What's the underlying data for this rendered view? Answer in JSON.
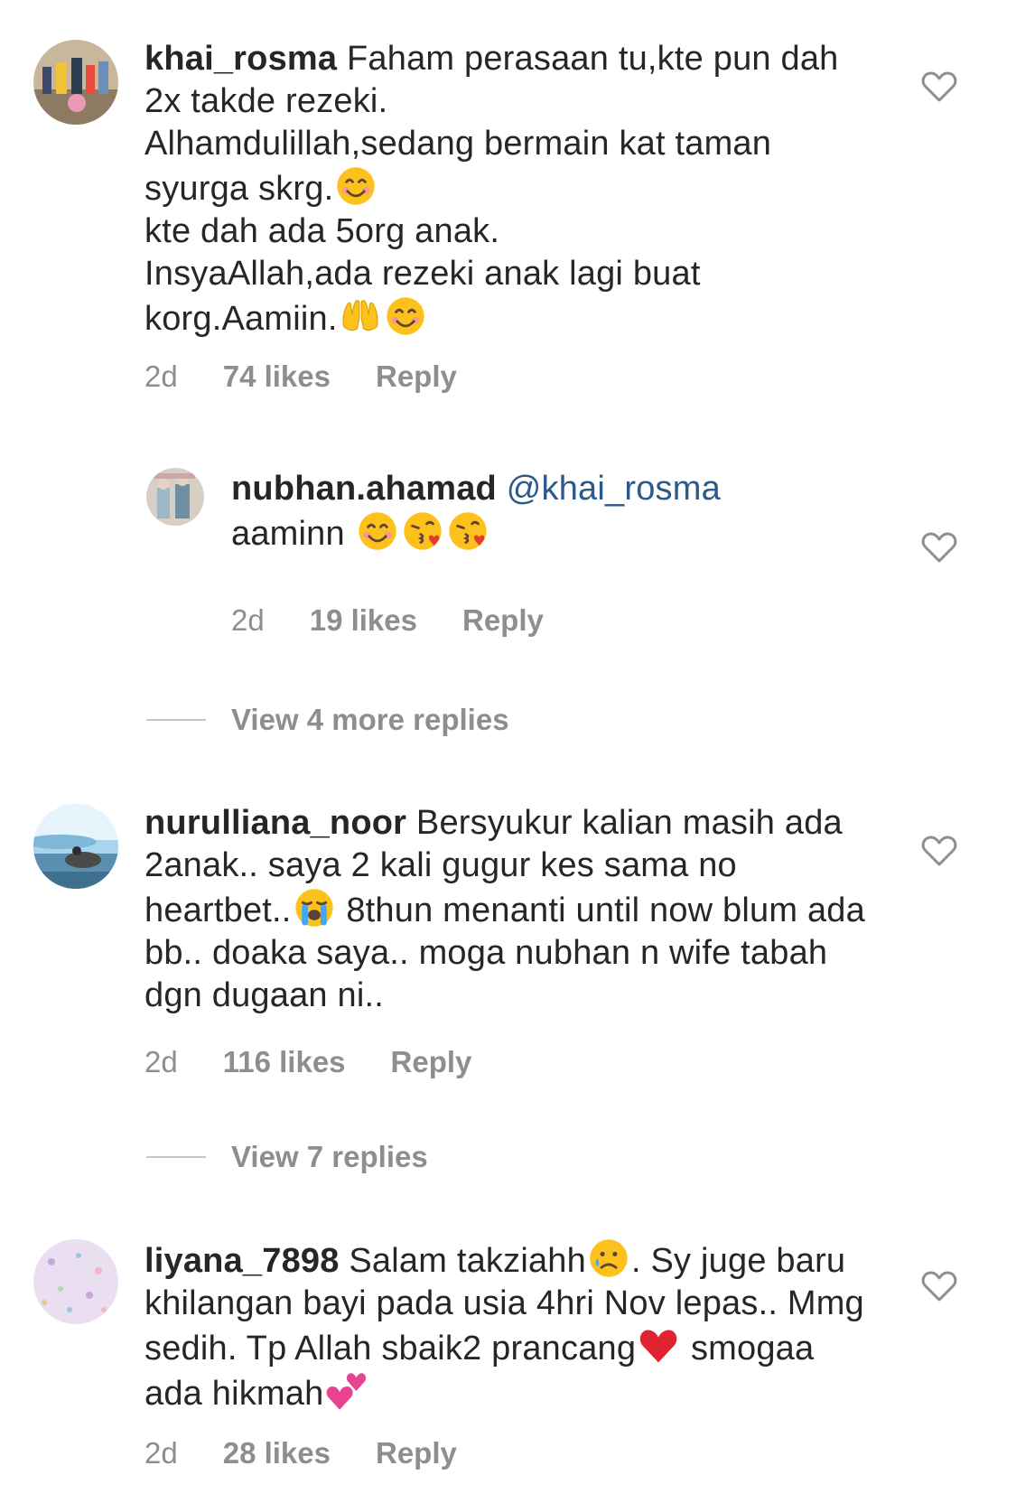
{
  "comments": [
    {
      "username": "khai_rosma",
      "body": " Faham perasaan tu,kte pun dah 2x takde rezeki.\nAlhamdulillah,sedang bermain kat taman syurga skrg.",
      "body2": "\nkte dah ada 5org anak.\nInsyaAllah,ada rezeki anak lagi buat korg.Aamiin.",
      "time": "2d",
      "likes": "74 likes",
      "reply": "Reply"
    },
    {
      "username": "nubhan.ahamad",
      "mention": " @khai_rosma",
      "body": "\naaminn ",
      "time": "2d",
      "likes": "19 likes",
      "reply": "Reply"
    },
    {
      "username": "nurulliana_noor",
      "body": " Bersyukur kalian masih ada 2anak.. saya 2 kali gugur kes sama no heartbet..",
      "body2": " 8thun menanti until now blum ada bb.. doaka saya.. moga nubhan n wife tabah dgn dugaan ni..",
      "time": "2d",
      "likes": "116 likes",
      "reply": "Reply"
    },
    {
      "username": "liyana_7898",
      "body": " Salam takziahh",
      "body2": ". Sy juge baru khilangan bayi pada usia 4hri Nov lepas.. Mmg sedih. Tp Allah sbaik2 prancang",
      "body3": " smogaa ada hikmah",
      "time": "2d",
      "likes": "28 likes",
      "reply": "Reply"
    }
  ],
  "view_replies": {
    "first": "View 4 more replies",
    "second": "View 7 replies"
  },
  "icons": {
    "heart": "heart-outline-icon",
    "smile": "smiling-face-emoji",
    "raised_hands": "raising-hands-emoji",
    "kiss": "face-blowing-kiss-emoji",
    "crying": "loudly-crying-face-emoji",
    "sad": "crying-face-emoji",
    "red_heart": "red-heart-emoji",
    "two_hearts": "two-hearts-emoji"
  }
}
